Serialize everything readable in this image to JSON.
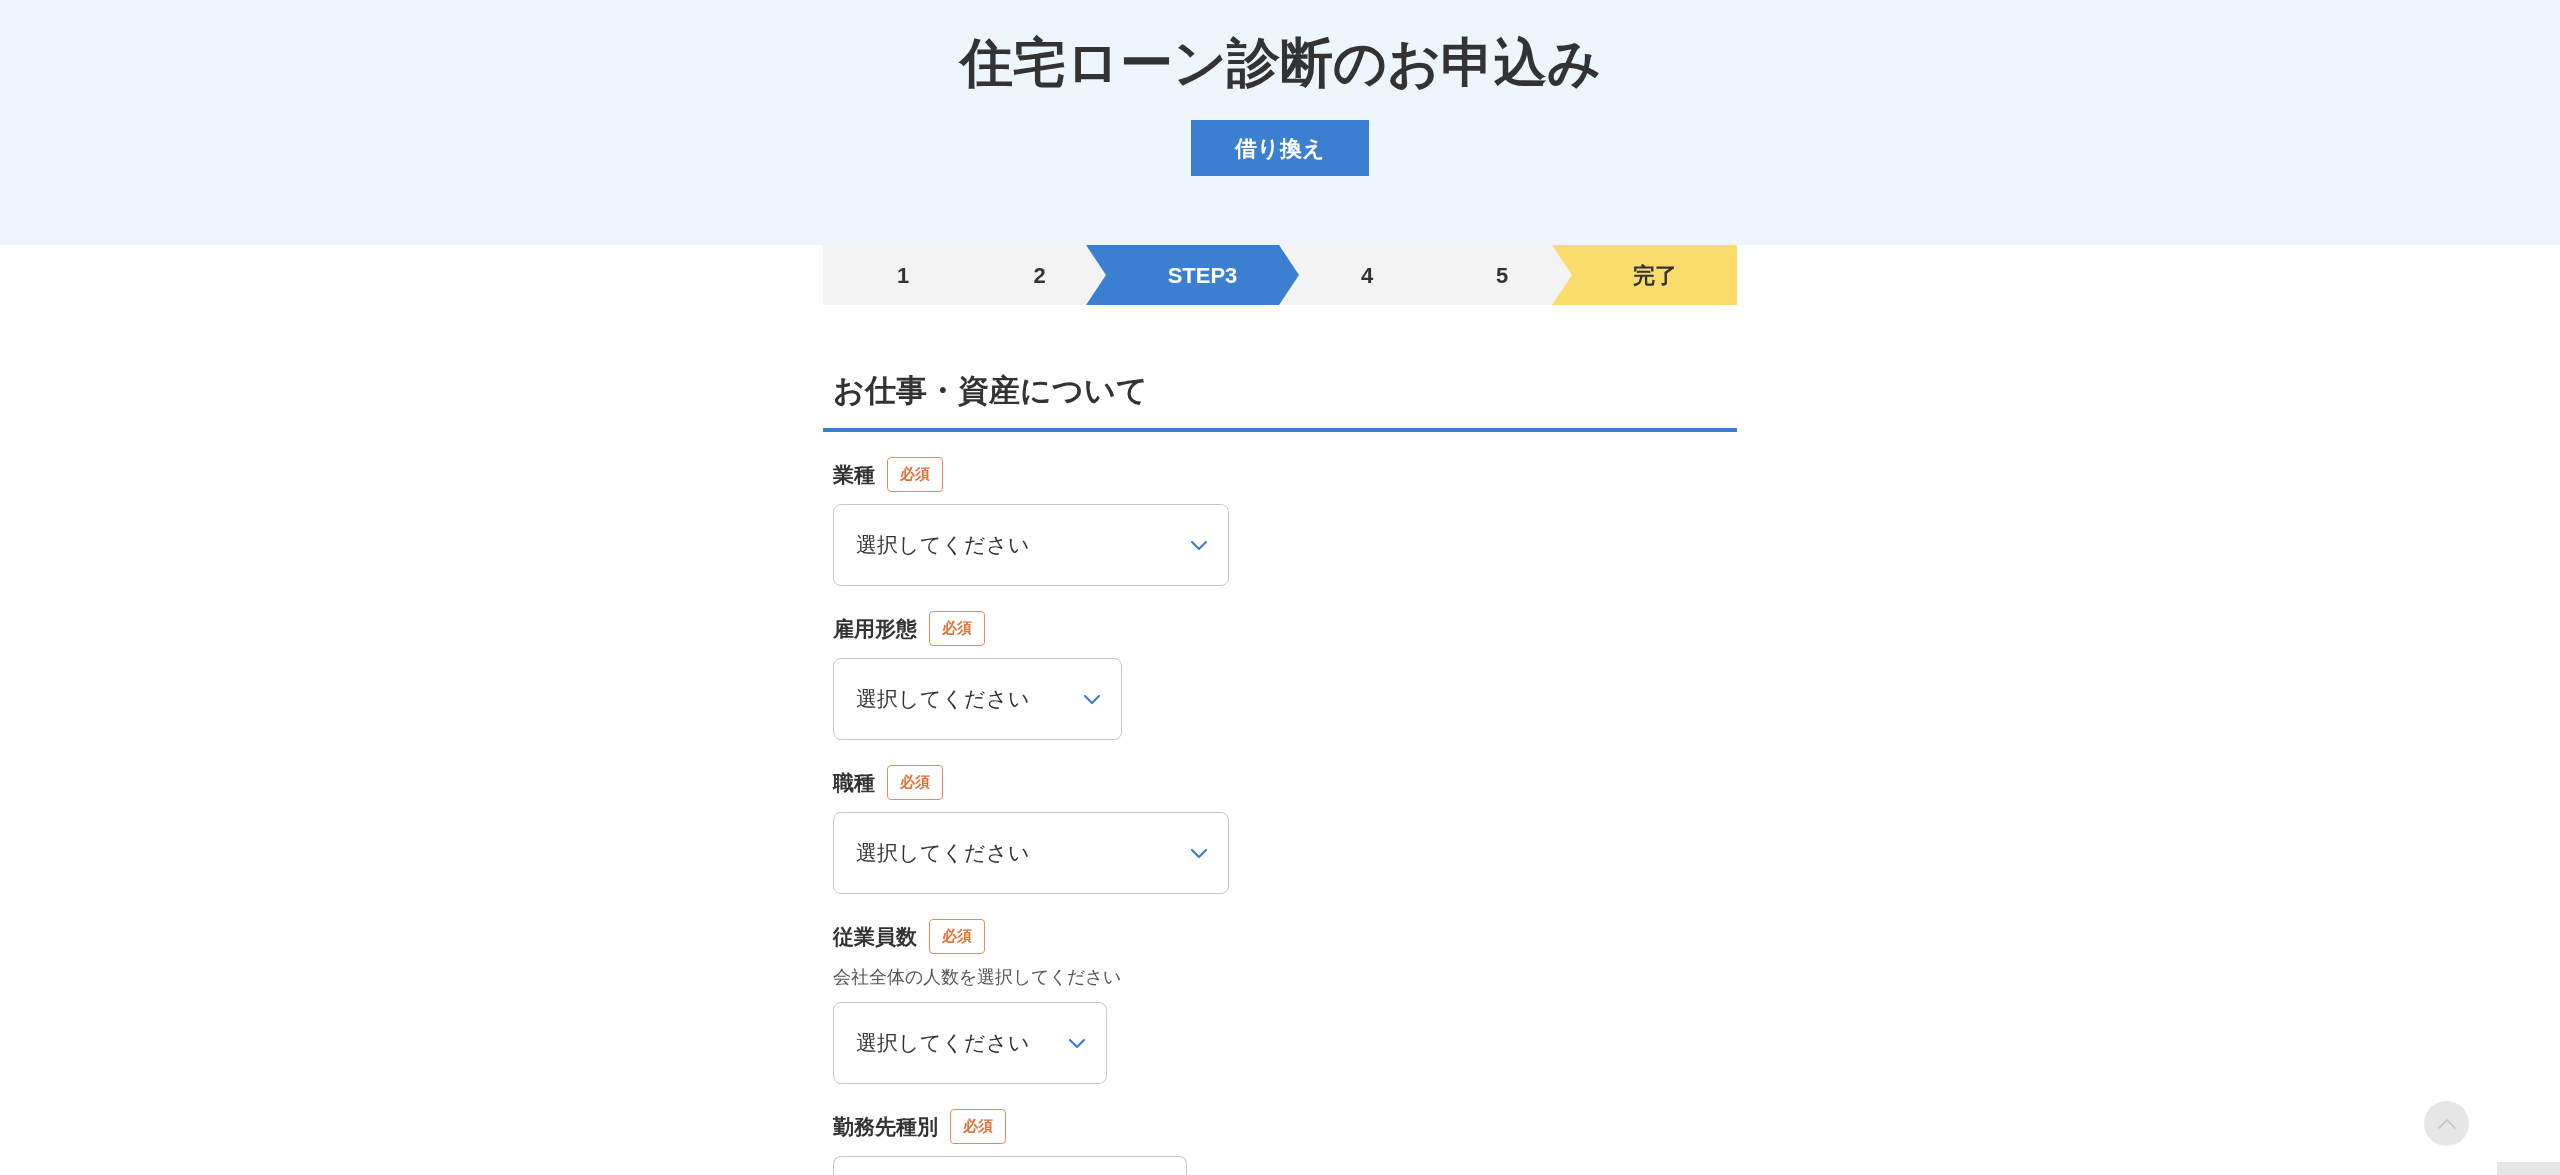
{
  "header": {
    "title": "住宅ローン診断のお申込み",
    "loan_type": "借り換え"
  },
  "steps": [
    {
      "label": "1",
      "kind": "step",
      "selected": false
    },
    {
      "label": "2",
      "kind": "step",
      "selected": false
    },
    {
      "label": "STEP3",
      "kind": "step",
      "selected": true
    },
    {
      "label": "4",
      "kind": "step",
      "selected": false
    },
    {
      "label": "5",
      "kind": "step",
      "selected": false
    },
    {
      "label": "完了",
      "kind": "goal",
      "selected": false
    }
  ],
  "section": {
    "title": "お仕事・資産について",
    "fields": [
      {
        "label": "業種",
        "badge": "必須",
        "placeholder": "選択してください"
      },
      {
        "label": "雇用形態",
        "badge": "必須",
        "placeholder": "選択してください"
      },
      {
        "label": "職種",
        "badge": "必須",
        "placeholder": "選択してください"
      },
      {
        "label": "従業員数",
        "badge": "必須",
        "hint": "会社全体の人数を選択してください",
        "placeholder": "選択してください"
      },
      {
        "label": "勤務先種別",
        "badge": "必須"
      }
    ]
  }
}
